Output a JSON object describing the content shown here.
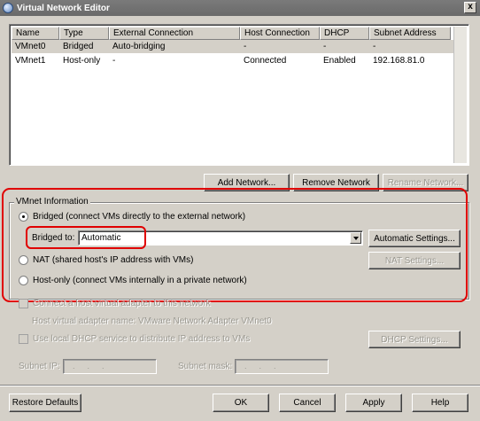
{
  "window": {
    "title": "Virtual Network Editor",
    "close_label": "x"
  },
  "network_list": {
    "columns": [
      "Name",
      "Type",
      "External Connection",
      "Host Connection",
      "DHCP",
      "Subnet Address"
    ],
    "rows": [
      [
        "VMnet0",
        "Bridged",
        "Auto-bridging",
        "-",
        "-",
        "-"
      ],
      [
        "VMnet1",
        "Host-only",
        "-",
        "Connected",
        "Enabled",
        "192.168.81.0"
      ]
    ]
  },
  "list_buttons": {
    "add": "Add Network...",
    "remove": "Remove Network",
    "rename": "Rename Network..."
  },
  "vmnet_info": {
    "title": "VMnet Information",
    "bridged": "Bridged (connect VMs directly to the external network)",
    "bridged_to_label": "Bridged to:",
    "bridged_to_value": "Automatic",
    "automatic_settings": "Automatic Settings...",
    "nat": "NAT (shared host's IP address with VMs)",
    "nat_settings": "NAT Settings...",
    "host_only": "Host-only (connect VMs internally in a private network)"
  },
  "adapter": {
    "connect_host": "Connect a host virtual adapter to this network",
    "adapter_name": "Host virtual adapter name: VMware Network Adapter VMnet0",
    "use_dhcp": "Use local DHCP service to distribute IP address to VMs",
    "dhcp_settings": "DHCP Settings..."
  },
  "subnet": {
    "ip_label": "Subnet IP:",
    "ip_value": "...",
    "mask_label": "Subnet mask:",
    "mask_value": "..."
  },
  "footer": {
    "restore": "Restore Defaults",
    "ok": "OK",
    "cancel": "Cancel",
    "apply": "Apply",
    "help": "Help"
  },
  "colors": {
    "highlight": "#e00000",
    "face": "#d4d0c8",
    "titlebar": "#6a6a6a"
  }
}
